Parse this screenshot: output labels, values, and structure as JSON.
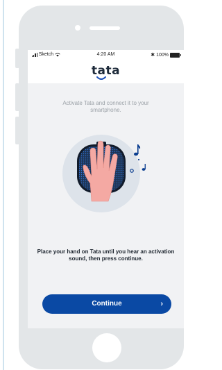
{
  "status_bar": {
    "carrier": "Sketch",
    "time": "4:20 AM",
    "battery": "100%",
    "icons": [
      "signal-icon",
      "wifi-icon",
      "bluetooth-icon",
      "battery-icon"
    ]
  },
  "header": {
    "logo_text": "tata"
  },
  "onboarding": {
    "subtitle": "Activate Tata and connect it to your smartphone.",
    "illustration_icons": [
      "hand-icon",
      "speaker-device-icon",
      "music-notes-icon"
    ],
    "instruction": "Place your hand on Tata until you hear an activation sound, then press continue."
  },
  "actions": {
    "continue_label": "Continue",
    "continue_icon": "chevron-right-icon"
  },
  "colors": {
    "primary": "#0a49a4",
    "phone_body": "#e3e6e8",
    "screen_bg": "#f1f2f4",
    "hand": "#f4a9a3",
    "device": "#1e3556",
    "device_dots": "#2f6fd0",
    "circle": "#dde3ea",
    "logo_accent": "#1a4fb8"
  }
}
